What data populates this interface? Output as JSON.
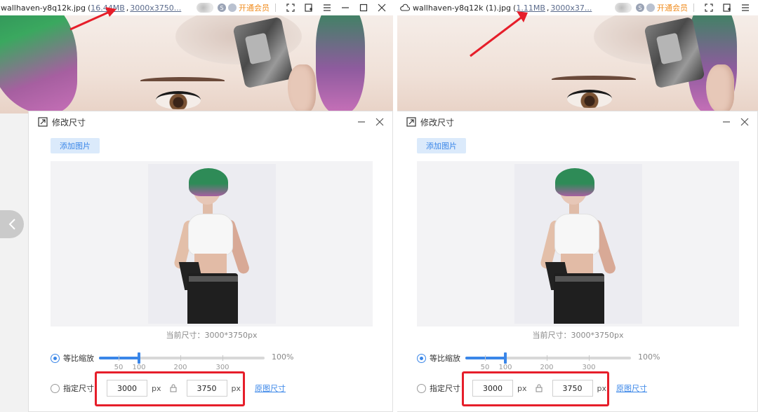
{
  "windows": [
    {
      "title": {
        "filename": "wallhaven-y8q12k.jpg",
        "open_paren": "(",
        "file_size": "16.44MB",
        "separator": ",",
        "dimensions": "3000x3750..."
      },
      "vip_label": "开通会员",
      "dialog": {
        "title": "修改尺寸",
        "add_image_button": "添加图片",
        "current_size_text": "当前尺寸：3000*3750px",
        "proportional_label": "等比缩放",
        "slider": {
          "value": 100,
          "max_label": "100%",
          "tick_labels": [
            "50",
            "100",
            "200",
            "300"
          ]
        },
        "specify_label": "指定尺寸",
        "width_value": "3000",
        "height_value": "3750",
        "unit": "px",
        "original_size_link": "原图尺寸"
      }
    },
    {
      "title": {
        "filename": "wallhaven-y8q12k (1).jpg",
        "open_paren": "(",
        "file_size": "1.11MB",
        "separator": ",",
        "dimensions": "3000x37..."
      },
      "vip_label": "开通会员",
      "dialog": {
        "title": "修改尺寸",
        "add_image_button": "添加图片",
        "current_size_text": "当前尺寸：3000*3750px",
        "proportional_label": "等比缩放",
        "slider": {
          "value": 100,
          "max_label": "100%",
          "tick_labels": [
            "50",
            "100",
            "200",
            "300"
          ]
        },
        "specify_label": "指定尺寸：",
        "width_value": "3000",
        "height_value": "3750",
        "unit": "px",
        "original_size_link": "原图尺寸"
      }
    }
  ],
  "colors": {
    "accent": "#3a86e8",
    "vip": "#f08c1e",
    "highlight_box": "#e61e2a",
    "annotation_arrow": "#e61e2a"
  }
}
